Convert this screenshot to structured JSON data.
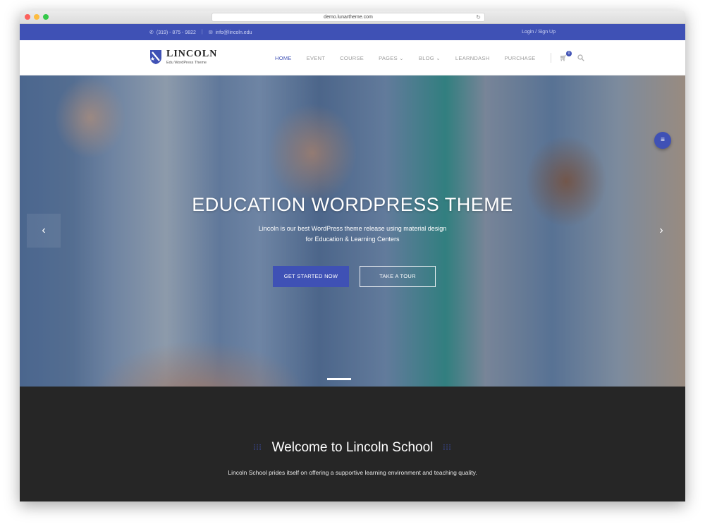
{
  "browser": {
    "url": "demo.lunartheme.com",
    "reload_icon": "reload-icon"
  },
  "topbar": {
    "phone": "(319) - 875 - 9822",
    "separator": "|",
    "email": "info@lincoln.edu",
    "auth_link": "Login / Sign Up"
  },
  "logo": {
    "title": "LINCOLN",
    "subtitle": "Edu WordPress Theme"
  },
  "nav": {
    "items": [
      "HOME",
      "EVENT",
      "COURSE",
      "PAGES",
      "BLOG",
      "LEARNDASH",
      "PURCHASE"
    ],
    "cart_count": "0"
  },
  "hero": {
    "title": "EDUCATION WORDPRESS THEME",
    "subtitle_line1": "Lincoln is our best WordPress theme release using material design",
    "subtitle_line2": "for Education & Learning Centers",
    "primary_button": "GET STARTED NOW",
    "secondary_button": "TAKE A TOUR",
    "arrow_left": "‹",
    "arrow_right": "›"
  },
  "fab": {
    "icon": "menu-icon"
  },
  "welcome": {
    "title": "Welcome to Lincoln School",
    "text": "Lincoln School prides itself on offering a supportive learning environment and teaching quality."
  },
  "colors": {
    "accent": "#3f51b5",
    "dark": "#262626"
  }
}
